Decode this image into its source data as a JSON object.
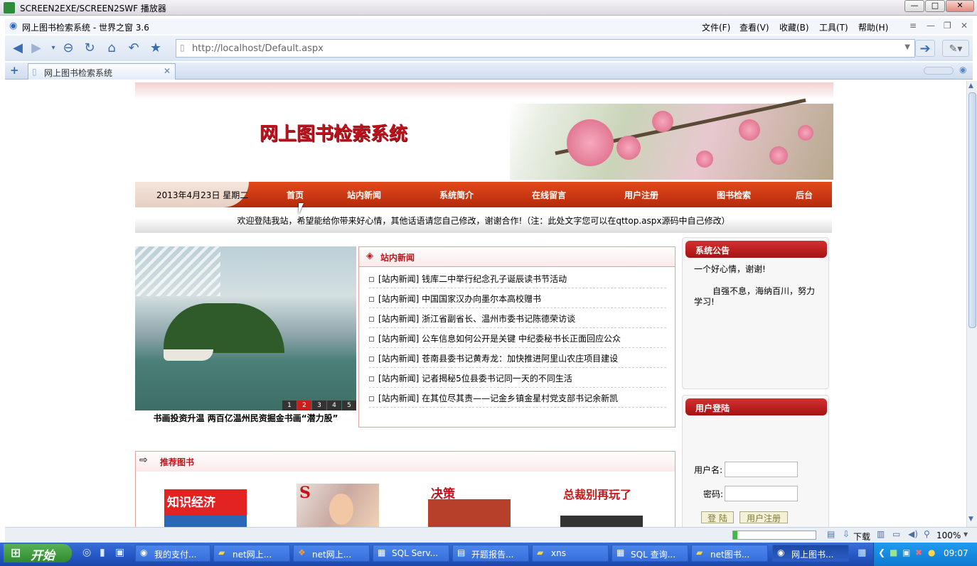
{
  "player": {
    "title": "SCREEN2EXE/SCREEN2SWF 播放器",
    "min": "—",
    "max": "□",
    "close": "✕"
  },
  "browser": {
    "title": "网上图书检索系统 - 世界之窗 3.6",
    "menu": [
      "文件(F)",
      "查看(V)",
      "收藏(B)",
      "工具(T)",
      "帮助(H)"
    ],
    "url": "http://localhost/Default.aspx",
    "tab_label": "网上图书检索系统"
  },
  "site": {
    "title": "网上图书检索系统",
    "date": "2013年4月23日  星期二",
    "nav": [
      "首页",
      "站内新闻",
      "系统简介",
      "在线留言",
      "用户注册",
      "图书检索",
      "后台"
    ],
    "welcome": "欢迎登陆我站，希望能给你带来好心情，其他话语请您自己修改，谢谢合作!（注：此处文字您可以在qttop.aspx源码中自己修改）"
  },
  "slideshow": {
    "numbers": [
      "1",
      "2",
      "3",
      "4",
      "5"
    ],
    "active": "2",
    "caption": "书画投资升温 两百亿温州民资掘金书画“潜力股”"
  },
  "news": {
    "title": "站内新闻",
    "items": [
      "[站内新闻] 钱库二中举行纪念孔子诞辰读书节活动",
      "[站内新闻] 中国国家汉办向墨尔本高校赠书",
      "[站内新闻] 浙江省副省长、温州市委书记陈德荣访谈",
      "[站内新闻] 公车信息如何公开是关键 中纪委秘书长正面回应公众",
      "[站内新闻] 苍南县委书记黄寿龙：加快推进阿里山农庄项目建设",
      "[站内新闻] 记者揭秘5位县委书记同一天的不同生活",
      "[站内新闻] 在其位尽其责——记金乡镇金星村党支部书记余新凯"
    ]
  },
  "recommended": {
    "title": "推荐图书",
    "books": [
      {
        "cover_text": "知识经济",
        "color": "#e32222"
      },
      {
        "cover_text": "",
        "color": "#c9a9a0"
      },
      {
        "cover_text": "决策",
        "color": "#b7402a"
      },
      {
        "cover_text": "总裁别再玩了",
        "color": "#c21b1b"
      }
    ]
  },
  "notice": {
    "title": "系统公告",
    "line1": "一个好心情，谢谢!",
    "line2": "自强不息，海纳百川，努力学习!"
  },
  "login": {
    "title": "用户登陆",
    "username_label": "用户名:",
    "password_label": "密码:",
    "login_btn": "登 陆",
    "register_btn": "用户注册"
  },
  "statusbar": {
    "download": "下载",
    "zoom": "100%"
  },
  "taskbar": {
    "start": "开始",
    "tasks": [
      "我的支付...",
      "net网上...",
      "net网上...",
      "SQL Serv...",
      "开题报告...",
      "xns",
      "SQL 查询...",
      "net图书...",
      "网上图书..."
    ],
    "clock": "09:07"
  }
}
